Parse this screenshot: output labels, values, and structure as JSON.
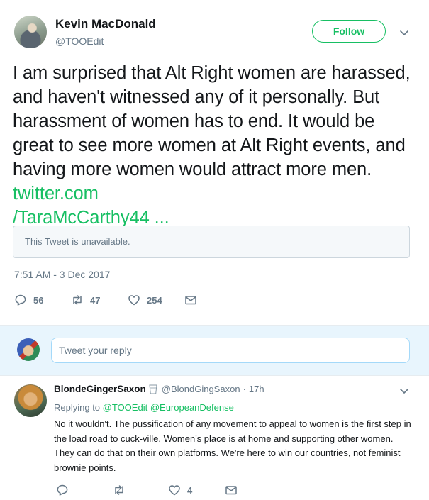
{
  "tweet": {
    "author_name": "Kevin MacDonald",
    "author_handle": "@TOOEdit",
    "follow_label": "Follow",
    "text": "I am surprised that Alt Right women are harassed, and haven't witnessed any of it personally. But harassment of women has to end. It would be great to see more women at Alt Right events, and having more women would attract more men. ",
    "link_line1": "twitter.com",
    "link_line2": "/TaraMcCarthy44 ...",
    "quoted_unavailable": "This Tweet is unavailable.",
    "timestamp": "7:51 AM - 3 Dec 2017",
    "replies_count": "56",
    "retweets_count": "47",
    "likes_count": "254"
  },
  "reply_box": {
    "placeholder": "Tweet your reply"
  },
  "reply": {
    "author_name": "BlondeGingerSaxon",
    "author_handle": "@BlondGingSaxon",
    "separator": "·",
    "time": "17h",
    "replying_prefix": "Replying to",
    "mention_1": "@TOOEdit",
    "mention_2": "@EuropeanDefense",
    "text": "No it wouldn't. The pussification of any movement to appeal to women is the first step in the load road to cuck-ville. Women's place is at home and supporting other women. They can do that on their own platforms. We're here to win our countries, not feminist brownie points.",
    "likes_count": "4"
  },
  "icons": {
    "reply": "reply-icon",
    "retweet": "retweet-icon",
    "like": "heart-icon",
    "dm": "envelope-icon",
    "more": "chevron-down-icon",
    "badge": "cup-icon"
  },
  "colors": {
    "accent": "#17bf63",
    "muted": "#657786",
    "text": "#14171a",
    "reply_bar_bg": "#e8f5fd"
  }
}
